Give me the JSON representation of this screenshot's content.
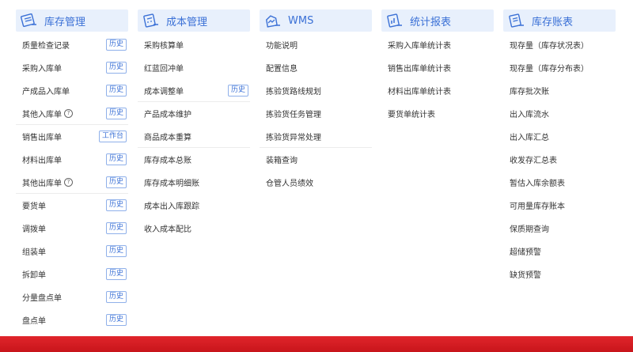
{
  "colors": {
    "accent": "#3a70d6",
    "header_bg": "#e8f0fc",
    "bottom_bar": "#d41e24"
  },
  "columns": [
    {
      "title": "库存管理",
      "icon": "clipboard-list-icon",
      "items": [
        {
          "label": "质量检查记录",
          "badge": "历史"
        },
        {
          "label": "采购入库单",
          "badge": "历史"
        },
        {
          "label": "产成品入库单",
          "badge": "历史"
        },
        {
          "label": "其他入库单",
          "badge": "历史",
          "help": "?"
        },
        {
          "label": "销售出库单",
          "badge": "工作台"
        },
        {
          "label": "材料出库单",
          "badge": "历史"
        },
        {
          "label": "其他出库单",
          "badge": "历史",
          "help": "?"
        },
        {
          "label": "要货单",
          "badge": "历史"
        },
        {
          "label": "调拨单",
          "badge": "历史"
        },
        {
          "label": "组装单",
          "badge": "历史"
        },
        {
          "label": "拆卸单",
          "badge": "历史"
        },
        {
          "label": "分量盘点单",
          "badge": "历史"
        },
        {
          "label": "盘点单",
          "badge": "历史"
        }
      ]
    },
    {
      "title": "成本管理",
      "icon": "calculator-icon",
      "items": [
        {
          "label": "采购核算单"
        },
        {
          "label": "红蓝回冲单"
        },
        {
          "label": "成本调整单",
          "badge": "历史"
        },
        {
          "label": "产品成本维护"
        },
        {
          "label": "商品成本重算"
        },
        {
          "label": "库存成本总账"
        },
        {
          "label": "库存成本明细账"
        },
        {
          "label": "成本出入库跟踪"
        },
        {
          "label": "收入成本配比"
        }
      ]
    },
    {
      "title": "WMS",
      "icon": "warehouse-icon",
      "items": [
        {
          "label": "功能说明"
        },
        {
          "label": "配置信息"
        },
        {
          "label": "拣验货路线规划"
        },
        {
          "label": "拣验货任务管理"
        },
        {
          "label": "拣验货异常处理"
        },
        {
          "label": "装箱查询"
        },
        {
          "label": "仓管人员绩效"
        }
      ]
    },
    {
      "title": "统计报表",
      "icon": "chart-report-icon",
      "items": [
        {
          "label": "采购入库单统计表"
        },
        {
          "label": "销售出库单统计表"
        },
        {
          "label": "材料出库单统计表"
        },
        {
          "label": "要货单统计表"
        }
      ]
    },
    {
      "title": "库存账表",
      "icon": "ledger-icon",
      "items": [
        {
          "label": "现存量（库存状况表）"
        },
        {
          "label": "现存量（库存分布表）"
        },
        {
          "label": "库存批次账"
        },
        {
          "label": "出入库流水"
        },
        {
          "label": "出入库汇总"
        },
        {
          "label": "收发存汇总表"
        },
        {
          "label": "暂估入库余额表"
        },
        {
          "label": "可用量库存账本"
        },
        {
          "label": "保质期查询"
        },
        {
          "label": "超储预警"
        },
        {
          "label": "缺货预警"
        }
      ]
    }
  ]
}
